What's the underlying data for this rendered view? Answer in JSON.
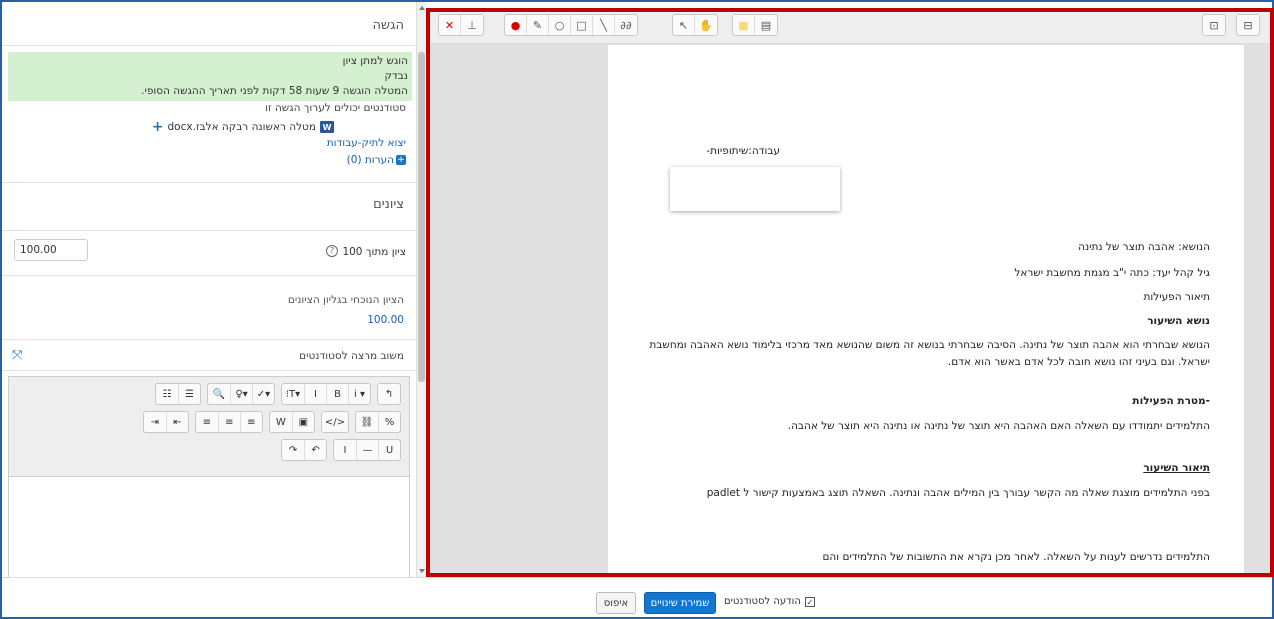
{
  "submission": {
    "title": "הגשה",
    "status_lines": [
      "הוגש למתן ציון",
      "נבדק",
      "המטלה הוגשה 9 שעות 58 דקות לפני תאריך ההגשה הסופי."
    ],
    "edit_note": "סטודנטים יכולים לערוך הגשה זו",
    "file_name": "מטלה ראשונה רבקה אלבז.docx",
    "export_link": "יצוא לתיק-עבודות",
    "comments_link": "הערות (0)"
  },
  "grades": {
    "title": "ציונים",
    "grade_label": "ציון מתוך 100",
    "grade_value": "100.00",
    "gradebook_label": "הציון הנוכחי בגליון הציונים",
    "gradebook_value": "100.00"
  },
  "feedback": {
    "label": "משוב מרצה לסטודנטים"
  },
  "editor_toolbar": {
    "row1": [
      [
        "↰"
      ],
      [
        "▾ i",
        "B",
        "I",
        "▾T⁝"
      ],
      [
        "▾✓",
        "▾♀",
        "🔍"
      ],
      [
        "☰",
        "☷"
      ]
    ],
    "row2": [
      [
        "%",
        "⛓"
      ],
      [
        "</>"
      ],
      [
        "▣",
        "W"
      ],
      [
        "≡",
        "≡",
        "≡"
      ],
      [
        "⇤",
        "⇥"
      ]
    ],
    "row3": [
      [
        "U",
        "—",
        "I"
      ],
      [
        "↶",
        "↷"
      ]
    ]
  },
  "pdf_toolbar": {
    "left_group": [
      "✕",
      "⊥"
    ],
    "draw_group": [
      "●",
      "✎",
      "○",
      "□",
      "╲",
      "∂∂"
    ],
    "nav_group": [
      "↖",
      "✋"
    ],
    "note_group": [
      "■",
      "▤"
    ],
    "right_group_a": [
      "⊡"
    ],
    "right_group_b": [
      "⊟"
    ]
  },
  "document": {
    "heading": "עבודה:שיתופיות-",
    "topic": "הנושא: אהבה תוצר של נתינה",
    "audience": "גיל קהל יעד: כתה י\"ב מגמת מחשבת ישראל",
    "activity_desc": "תיאור הפעילות",
    "lesson_topic_title": "נושא השיעור",
    "lesson_topic_text": "הנושא שבחרתי הוא אהבה תוצר של נתינה. הסיבה שבחרתי בנושא זה משום שהנושא מאד מרכזי בלימוד נושא האהבה ומחשבת ישראל. וגם בעיני זהו נושא חובה לכל אדם באשר הוא אדם.",
    "goal_title": "-מטרת הפעילות",
    "goal_text": "התלמידים יתמודדו עם השאלה האם האהבה  היא תוצר של נתינה או נתינה היא תוצר של אהבה.",
    "lesson_desc_title": "תיאור השיעור",
    "lesson_desc_text": "בפני התלמידים מוצגת שאלה מה הקשר עבורך בין המילים אהבה ונתינה. השאלה תוצג באמצעות קישור ל padlet",
    "bottom_text": "התלמידים נדרשים לענות על השאלה. לאחר מכן נקרא את התשובות של התלמידים והם"
  },
  "footer": {
    "save_label": "שמירת שינויים",
    "reset_label": "איפוס",
    "notify_label": "הודעה לסטודנטים"
  },
  "colors": {
    "accent": "#1177d1",
    "status_bg": "#d5f0d0",
    "highlight": "#c00000",
    "frame": "#2b5ea8"
  }
}
